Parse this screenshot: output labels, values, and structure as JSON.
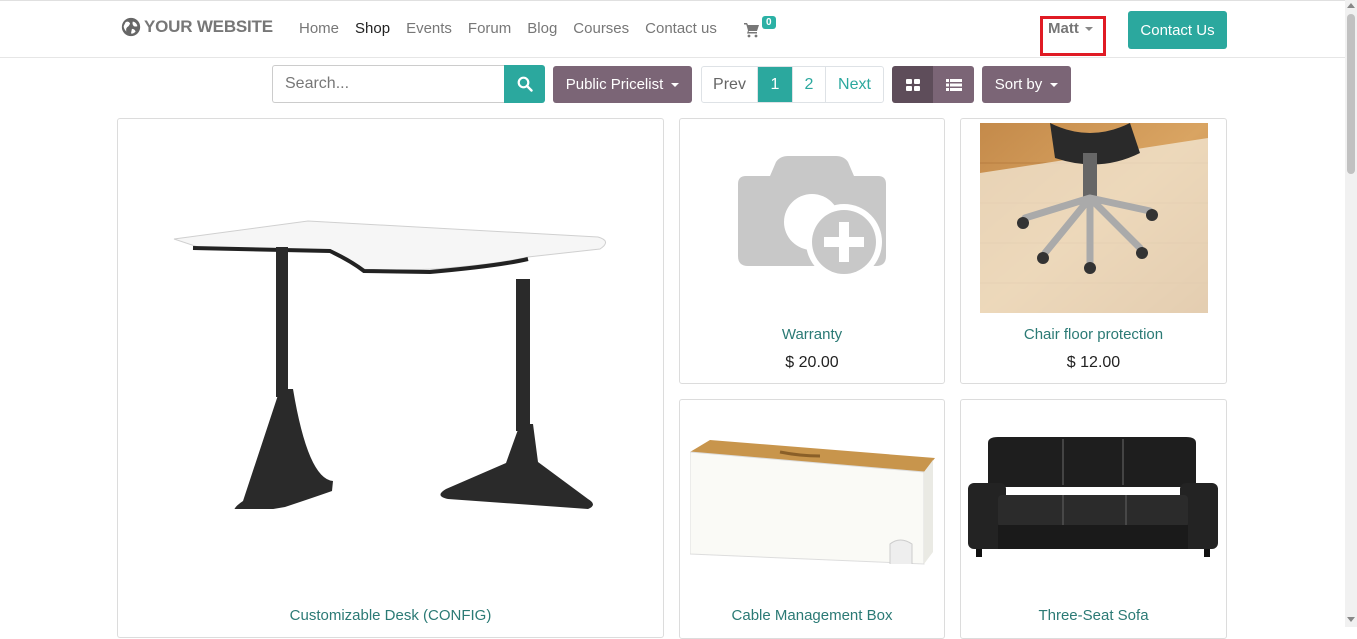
{
  "header": {
    "logo_text": "YOUR WEBSITE",
    "nav": [
      "Home",
      "Shop",
      "Events",
      "Forum",
      "Blog",
      "Courses",
      "Contact us"
    ],
    "active_nav": "Shop",
    "cart_count": "0",
    "user_name": "Matt",
    "contact_button": "Contact Us"
  },
  "toolbar": {
    "search_placeholder": "Search...",
    "pricelist_label": "Public Pricelist",
    "pager": {
      "prev": "Prev",
      "pages": [
        "1",
        "2"
      ],
      "current": "1",
      "next": "Next"
    },
    "sort_label": "Sort by"
  },
  "products": [
    {
      "name": "Customizable Desk (CONFIG)",
      "price": ""
    },
    {
      "name": "Warranty",
      "price": "$ 20.00"
    },
    {
      "name": "Chair floor protection",
      "price": "$ 12.00"
    },
    {
      "name": "Cable Management Box",
      "price": ""
    },
    {
      "name": "Three-Seat Sofa",
      "price": ""
    }
  ],
  "colors": {
    "accent": "#2ba89e",
    "secondary": "#7b6576",
    "highlight": "#e01b24"
  }
}
